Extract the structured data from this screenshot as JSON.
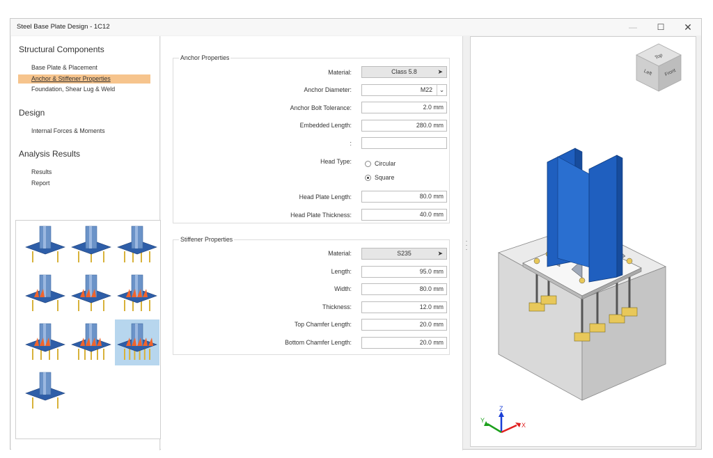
{
  "window": {
    "title": "Steel Base Plate Design - 1C12",
    "controls": {
      "minimize": "—",
      "maximize": "☐",
      "close": "✕"
    }
  },
  "sidebar": {
    "sections": [
      {
        "title": "Structural Components",
        "items": [
          "Base Plate & Placement",
          "Anchor & Stiffener Properties",
          "Foundation, Shear Lug & Weld"
        ]
      },
      {
        "title": "Design",
        "items": [
          "Internal Forces & Moments"
        ]
      },
      {
        "title": "Analysis Results",
        "items": [
          "Results",
          "Report"
        ]
      }
    ],
    "active_item": "Anchor & Stiffener Properties"
  },
  "gallery": {
    "count": 10,
    "selected_index": 8
  },
  "anchor": {
    "title": "Anchor Properties",
    "material_label": "Material:",
    "material_value": "Class 5.8",
    "diameter_label": "Anchor Diameter:",
    "diameter_value": "M22",
    "tolerance_label": "Anchor Bolt Tolerance:",
    "tolerance_value": "2.0 mm",
    "embedded_label": "Embedded Length:",
    "embedded_value": "280.0 mm",
    "blank_label": ":",
    "blank_value": "",
    "headtype_label": "Head Type:",
    "headtype_options": [
      "Circular",
      "Square"
    ],
    "headtype_selected": "Square",
    "headlen_label": "Head Plate Length:",
    "headlen_value": "80.0 mm",
    "headthk_label": "Head Plate Thickness:",
    "headthk_value": "40.0 mm"
  },
  "stiffener": {
    "title": "Stiffener Properties",
    "material_label": "Material:",
    "material_value": "S235",
    "length_label": "Length:",
    "length_value": "95.0 mm",
    "width_label": "Width:",
    "width_value": "80.0 mm",
    "thickness_label": "Thickness:",
    "thickness_value": "12.0 mm",
    "topch_label": "Top Chamfer Length:",
    "topch_value": "20.0 mm",
    "botch_label": "Bottom Chamfer Length:",
    "botch_value": "20.0 mm"
  },
  "viewport": {
    "viewcube": {
      "top": "Top",
      "left": "Left",
      "front": "Front"
    },
    "axes": {
      "x": "X",
      "y": "Y",
      "z": "Z"
    }
  },
  "colors": {
    "active_nav": "#f6c48d",
    "selected_thumb": "#b7d6ee",
    "steel_column": "#1f5fbf",
    "concrete": "#d4d4d4",
    "washer": "#e8c85a",
    "stiffener": "#f0642d"
  }
}
